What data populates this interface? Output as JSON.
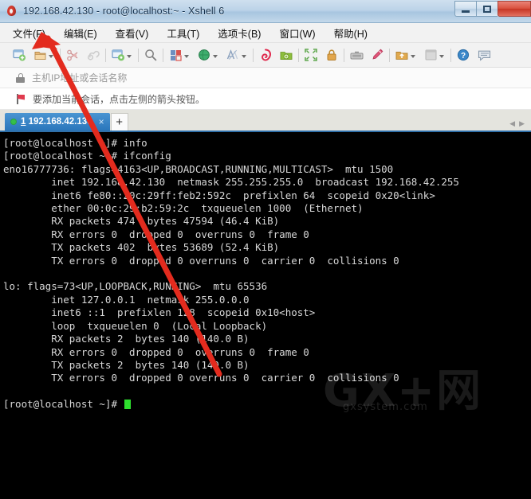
{
  "window": {
    "title": "192.168.42.130 - root@localhost:~ - Xshell 6",
    "minimize_label": "",
    "maximize_label": "",
    "close_label": ""
  },
  "menubar": {
    "items": [
      {
        "label": "文件(F)"
      },
      {
        "label": "编辑(E)"
      },
      {
        "label": "查看(V)"
      },
      {
        "label": "工具(T)"
      },
      {
        "label": "选项卡(B)"
      },
      {
        "label": "窗口(W)"
      },
      {
        "label": "帮助(H)"
      }
    ]
  },
  "toolbar": {
    "icons": [
      {
        "name": "new-session-icon",
        "glyph": "▣"
      },
      {
        "name": "open-session-icon",
        "glyph": "▤"
      },
      {
        "name": "disconnect-icon",
        "glyph": "✂"
      },
      {
        "name": "reconnect-icon",
        "glyph": "⚯"
      },
      {
        "name": "properties-icon",
        "glyph": "▥"
      },
      {
        "name": "find-icon",
        "glyph": "🔍"
      },
      {
        "name": "layout-icon",
        "glyph": "▦"
      },
      {
        "name": "globe-icon",
        "glyph": "●"
      },
      {
        "name": "font-icon",
        "glyph": "A"
      },
      {
        "name": "xshell-icon",
        "glyph": "@"
      },
      {
        "name": "xftp-icon",
        "glyph": "▣"
      },
      {
        "name": "fullscreen-icon",
        "glyph": "⛶"
      },
      {
        "name": "lock-icon",
        "glyph": "🔒"
      },
      {
        "name": "keyboard-icon",
        "glyph": "⌨"
      },
      {
        "name": "highlight-icon",
        "glyph": "✎"
      },
      {
        "name": "folder-icon",
        "glyph": "▣"
      },
      {
        "name": "panel-icon",
        "glyph": "▢"
      },
      {
        "name": "help-icon",
        "glyph": "?"
      },
      {
        "name": "feedback-icon",
        "glyph": "💬"
      }
    ]
  },
  "addressbar": {
    "placeholder": "主机IP地址或会话名称",
    "lock_icon": "lock-icon"
  },
  "notice": {
    "text": "要添加当前会话，点击左侧的箭头按钮。",
    "icon": "flag-icon"
  },
  "tabs": {
    "items": [
      {
        "index": "1",
        "label": "192.168.42.130",
        "status": "connected",
        "close": "×"
      }
    ],
    "new_tab_label": "+",
    "nav_prev": "◀",
    "nav_next": "▶"
  },
  "terminal": {
    "lines": [
      "[root@localhost ~]# info",
      "[root@localhost ~]# ifconfig",
      "eno16777736: flags=4163<UP,BROADCAST,RUNNING,MULTICAST>  mtu 1500",
      "        inet 192.168.42.130  netmask 255.255.255.0  broadcast 192.168.42.255",
      "        inet6 fe80::20c:29ff:feb2:592c  prefixlen 64  scopeid 0x20<link>",
      "        ether 00:0c:29:b2:59:2c  txqueuelen 1000  (Ethernet)",
      "        RX packets 474  bytes 47594 (46.4 KiB)",
      "        RX errors 0  dropped 0  overruns 0  frame 0",
      "        TX packets 402  bytes 53689 (52.4 KiB)",
      "        TX errors 0  dropped 0 overruns 0  carrier 0  collisions 0",
      "",
      "lo: flags=73<UP,LOOPBACK,RUNNING>  mtu 65536",
      "        inet 127.0.0.1  netmask 255.0.0.0",
      "        inet6 ::1  prefixlen 128  scopeid 0x10<host>",
      "        loop  txqueuelen 0  (Local Loopback)",
      "        RX packets 2  bytes 140 (140.0 B)",
      "        RX errors 0  dropped 0  overruns 0  frame 0",
      "        TX packets 2  bytes 140 (140.0 B)",
      "        TX errors 0  dropped 0 overruns 0  carrier 0  collisions 0",
      ""
    ],
    "prompt": "[root@localhost ~]# ",
    "fg_color": "#d8d8d8",
    "bg_color": "#000000",
    "cursor_color": "#2ee02e"
  },
  "watermark": {
    "text": "GX+网",
    "sub_text": "gxsystem.com"
  },
  "annotation": {
    "arrow_color": "#e32b1e",
    "description": "red-arrow-pointing-to-file-menu"
  }
}
